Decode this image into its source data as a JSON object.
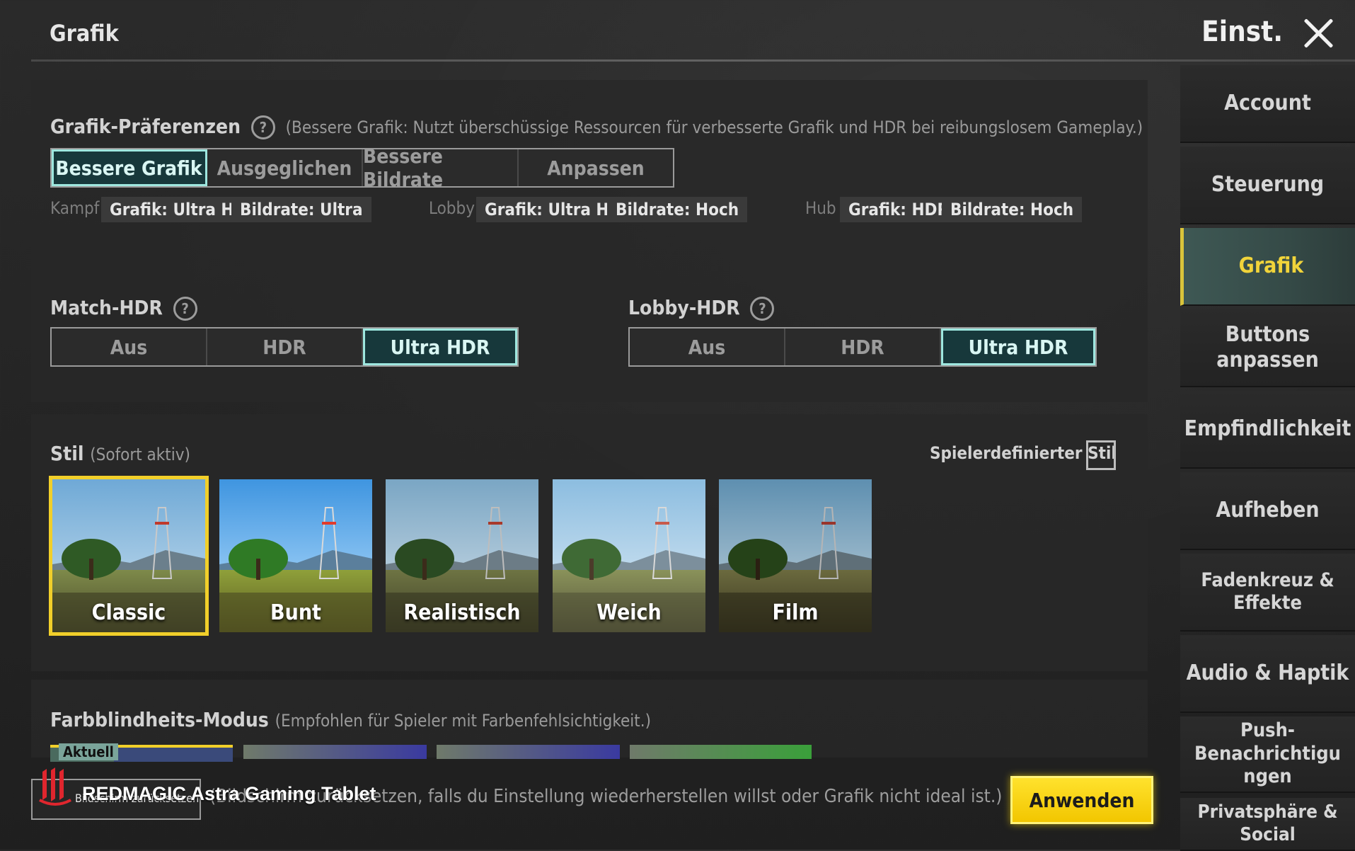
{
  "header": {
    "title": "Grafik",
    "settings_label": "Einst."
  },
  "sidebar": {
    "items": [
      {
        "label": "Account"
      },
      {
        "label": "Steuerung"
      },
      {
        "label": "Grafik"
      },
      {
        "label": "Buttons anpassen"
      },
      {
        "label": "Empfindlichkeit"
      },
      {
        "label": "Aufheben"
      },
      {
        "label": "Fadenkreuz & Effekte"
      },
      {
        "label": "Audio & Haptik"
      },
      {
        "label": "Push-Benachrichtigungen"
      },
      {
        "label": "Privatsphäre & Social"
      }
    ],
    "active_index": 2,
    "active_color": "#f1d43a"
  },
  "preferences": {
    "title": "Grafik-Präferenzen",
    "hint": "(Bessere Grafik: Nutzt überschüssige Ressourcen für verbesserte Grafik und HDR bei reibungslosem Gameplay.)",
    "options": [
      "Bessere Grafik",
      "Ausgeglichen",
      "Bessere Bildrate",
      "Anpassen"
    ],
    "selected": "Bessere Grafik",
    "info": {
      "kampf": {
        "label": "Kampf",
        "grafik": "Grafik: Ultra HD",
        "bildrate": "Bildrate: Ultra"
      },
      "lobby": {
        "label": "Lobby",
        "grafik": "Grafik: Ultra HD",
        "bildrate": "Bildrate: Hoch"
      },
      "hub": {
        "label": "Hub",
        "grafik": "Grafik: HDR",
        "bildrate": "Bildrate: Hoch"
      }
    }
  },
  "match_hdr": {
    "title": "Match-HDR",
    "options": [
      "Aus",
      "HDR",
      "Ultra HDR"
    ],
    "selected": "Ultra HDR"
  },
  "lobby_hdr": {
    "title": "Lobby-HDR",
    "options": [
      "Aus",
      "HDR",
      "Ultra HDR"
    ],
    "selected": "Ultra HDR"
  },
  "style": {
    "title": "Stil",
    "hint": "(Sofort aktiv)",
    "custom_label": "Spielerdefinierter Stil",
    "custom_checked": false,
    "options": [
      "Classic",
      "Bunt",
      "Realistisch",
      "Weich",
      "Film"
    ],
    "selected": "Classic",
    "selected_color": "#f1cf2a"
  },
  "colorblind": {
    "title": "Farbblindheits-Modus",
    "hint": "(Empfohlen für Spieler mit Farbenfehlsichtigkeit.)",
    "current_label": "Aktuell"
  },
  "footer": {
    "reset_label": "Bildschirm zurücksetzen",
    "reset_hint": "(Bildschirm zurücksetzen, falls du Einstellung wiederherstellen willst oder Grafik nicht ideal ist.)",
    "apply_label": "Anwenden",
    "apply_color": "#ffe22d"
  },
  "watermark": {
    "text": "REDMAGIC Astra Gaming Tablet",
    "icon": "redmagic-logo-icon"
  }
}
